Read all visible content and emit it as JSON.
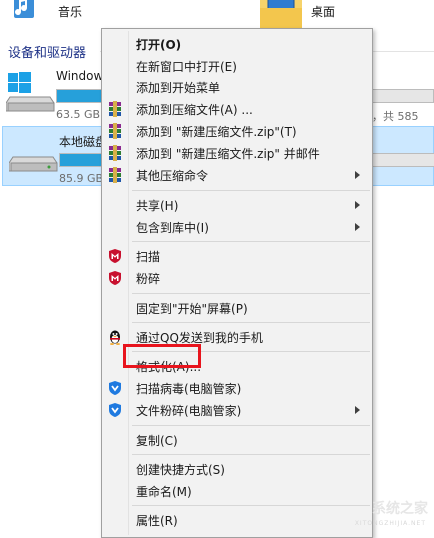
{
  "explorer": {
    "tiles": [
      {
        "label": "音乐"
      },
      {
        "label": "桌面"
      }
    ],
    "section_header": "设备和驱动器",
    "drives": [
      {
        "name": "Window",
        "size": "63.5 GB",
        "total": "，共 585",
        "fill_fraction": 0.55
      },
      {
        "name": "本地磁盘",
        "size": "85.9 GB",
        "total": "",
        "fill_fraction": 0.2
      }
    ]
  },
  "context_menu": {
    "items": [
      {
        "label": "打开(O)",
        "bold": true
      },
      {
        "label": "在新窗口中打开(E)"
      },
      {
        "label": "添加到开始菜单"
      },
      {
        "label": "添加到压缩文件(A) ...",
        "icon": "winrar-icon"
      },
      {
        "label": "添加到 \"新建压缩文件.zip\"(T)",
        "icon": "winrar-icon"
      },
      {
        "label": "添加到 \"新建压缩文件.zip\" 并邮件",
        "icon": "winrar-icon"
      },
      {
        "label": "其他压缩命令",
        "icon": "winrar-icon",
        "submenu": true
      },
      {
        "label": "共享(H)",
        "submenu": true
      },
      {
        "label": "包含到库中(I)",
        "submenu": true
      },
      {
        "label": "扫描",
        "icon": "mcafee-icon"
      },
      {
        "label": "粉碎",
        "icon": "mcafee-icon"
      },
      {
        "label": "固定到\"开始\"屏幕(P)"
      },
      {
        "label": "通过QQ发送到我的手机",
        "icon": "qq-penguin-icon"
      },
      {
        "label": "格式化(A)...",
        "highlighted": true
      },
      {
        "label": "扫描病毒(电脑管家)",
        "icon": "tencent-shield-icon"
      },
      {
        "label": "文件粉碎(电脑管家)",
        "icon": "tencent-shield-icon",
        "submenu": true
      },
      {
        "label": "复制(C)"
      },
      {
        "label": "创建快捷方式(S)"
      },
      {
        "label": "重命名(M)"
      },
      {
        "label": "属性(R)"
      }
    ]
  },
  "watermark": {
    "text": "系统之家",
    "sub": "XITONGZHIJIA.NET"
  },
  "colors": {
    "selection": "#cce8ff",
    "drive_bar": "#26a0da",
    "highlight_box": "#e8141d",
    "menu_bg": "#f2f2f2"
  }
}
